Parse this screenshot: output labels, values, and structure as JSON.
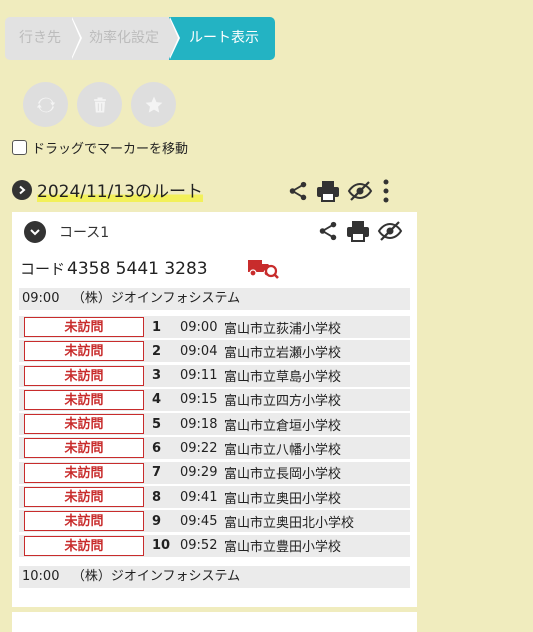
{
  "breadcrumb": {
    "items": [
      "行き先",
      "効率化設定",
      "ルート表示"
    ],
    "active_index": 2
  },
  "actions": {
    "refresh": "refresh-icon",
    "delete": "trash-icon",
    "favorite": "star-icon"
  },
  "drag_option": {
    "label": "ドラッグでマーカーを移動",
    "checked": false
  },
  "route": {
    "title": "2024/11/13のルート"
  },
  "course": {
    "label": "コース1",
    "code_label": "コード",
    "code_value": "4358 5441 3283",
    "start": {
      "time": "09:00",
      "name": "（株）ジオインフォシステム"
    },
    "end": {
      "time": "10:00",
      "name": "（株）ジオインフォシステム"
    },
    "stops": [
      {
        "status": "未訪問",
        "no": "1",
        "time": "09:00",
        "name": "富山市立荻浦小学校"
      },
      {
        "status": "未訪問",
        "no": "2",
        "time": "09:04",
        "name": "富山市立岩瀬小学校"
      },
      {
        "status": "未訪問",
        "no": "3",
        "time": "09:11",
        "name": "富山市立草島小学校"
      },
      {
        "status": "未訪問",
        "no": "4",
        "time": "09:15",
        "name": "富山市立四方小学校"
      },
      {
        "status": "未訪問",
        "no": "5",
        "time": "09:18",
        "name": "富山市立倉垣小学校"
      },
      {
        "status": "未訪問",
        "no": "6",
        "time": "09:22",
        "name": "富山市立八幡小学校"
      },
      {
        "status": "未訪問",
        "no": "7",
        "time": "09:29",
        "name": "富山市立長岡小学校"
      },
      {
        "status": "未訪問",
        "no": "8",
        "time": "09:41",
        "name": "富山市立奥田小学校"
      },
      {
        "status": "未訪問",
        "no": "9",
        "time": "09:45",
        "name": "富山市立奥田北小学校"
      },
      {
        "status": "未訪問",
        "no": "10",
        "time": "09:52",
        "name": "富山市立豊田小学校"
      }
    ]
  },
  "colors": {
    "background": "#f0ecbe",
    "active_tab": "#23b3c3",
    "unvisited": "#c82c2c",
    "highlight": "#f2f05a"
  }
}
